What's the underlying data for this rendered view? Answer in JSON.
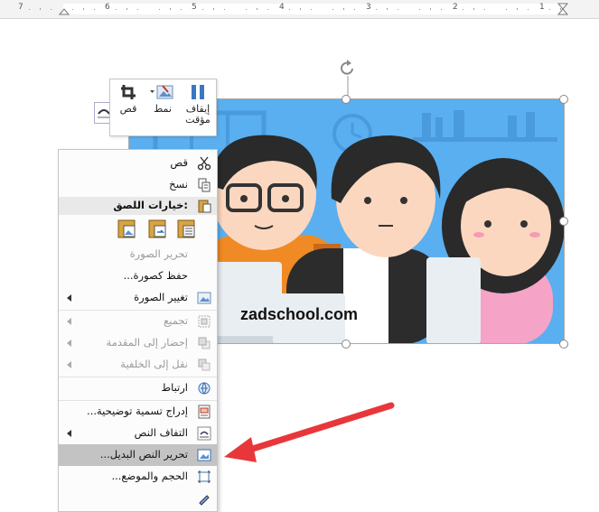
{
  "ruler": {
    "numbers": [
      "7",
      "6",
      "5",
      "4",
      "3",
      "2",
      "1"
    ]
  },
  "picture": {
    "watermark": "zadschool.com",
    "colors": {
      "background": "#5aaff0",
      "shelf": "#4a9ade"
    }
  },
  "mini_toolbar": {
    "crop_label": "قص",
    "style_label": "نمط",
    "pause_label_line1": "إيقاف",
    "pause_label_line2": "مؤقت"
  },
  "context_menu": {
    "cut": "قص",
    "copy": "نسخ",
    "paste_options": "خيارات اللصق:",
    "edit_picture": "تحرير الصورة",
    "save_as_picture": "حفظ كصورة...",
    "change_picture": "تغيير الصورة",
    "group": "تجميع",
    "bring_to_front": "إحضار إلى المقدمة",
    "send_to_back": "نقل إلى الخلفية",
    "link": "ارتباط",
    "insert_caption": "إدراج تسمية توضيحية...",
    "wrap_text": "التفاف النص",
    "edit_alt_text": "تحرير النص البديل...",
    "size_position": "الحجم والموضع..."
  },
  "colors": {
    "annotation_arrow": "#e8373a",
    "highlight": "#c3c3c3"
  }
}
